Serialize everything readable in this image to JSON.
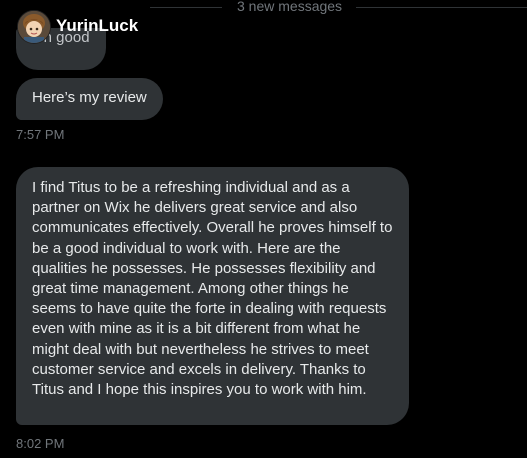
{
  "header": {
    "username": "YurinLuck",
    "avatar_icon": "user-avatar-icon"
  },
  "divider": {
    "label": "3 new messages"
  },
  "messages": [
    {
      "text": "Oh good"
    },
    {
      "text": "Here’s my review"
    },
    {
      "text": "I find Titus to be a refreshing individual and as a partner on Wix he delivers great service and also communicates effectively. Overall he proves himself to be a good individual to work with. Here are the qualities he possesses. He possesses flexibility and great time management. Among other things he seems to have quite the forte in dealing with requests even with mine as it is a bit different from what he might deal with but nevertheless he strives to meet customer service and excels in delivery. Thanks to Titus and I hope this inspires you to work with him."
    }
  ],
  "timestamps": [
    "7:57 PM",
    "8:02 PM"
  ],
  "colors": {
    "background": "#000000",
    "bubble": "#2f3336",
    "text": "#e7e9ea",
    "muted": "#71767b"
  }
}
